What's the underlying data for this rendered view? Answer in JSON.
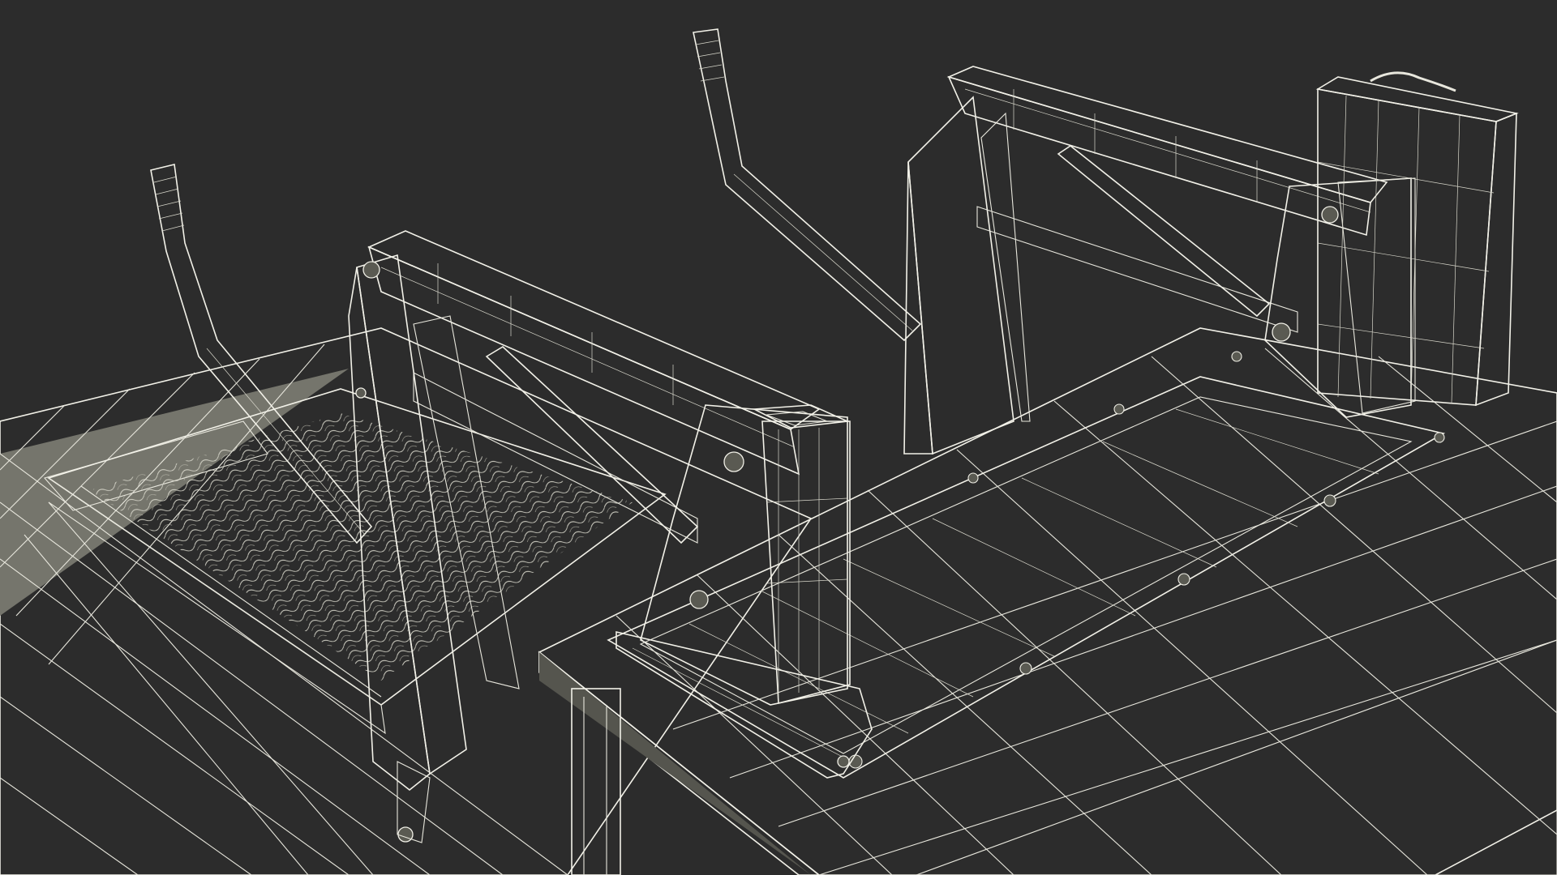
{
  "scene": {
    "subject": "wireframe-render",
    "colors": {
      "background": "#2c2c2c",
      "surface": "#6f6f66",
      "surface_dark": "#5c5c54",
      "surface_light": "#7b7b72",
      "wire": "#e8e7dd"
    }
  }
}
